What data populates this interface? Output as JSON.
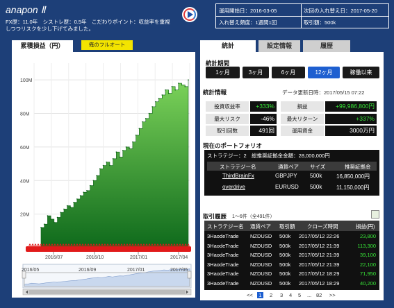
{
  "header": {
    "title": "anapon Ⅱ",
    "desc_line1": "FX歴：11.0年　シストレ歴：0.5年　こだわりポイント：収益率を重視",
    "desc_line2": "しつつリスクを少し下げてみました。",
    "info": {
      "start_label": "運用開始日：2016-03-05",
      "next_label": "次回の入れ替え日：2017-05-20",
      "freq_label": "入れ替え頻度：1週間1回",
      "lot_label": "取引額：500k"
    }
  },
  "left": {
    "tab": "累積損益（円）",
    "auto_button": "俺のフルオート"
  },
  "right": {
    "tabs": [
      "統計",
      "設定情報",
      "履歴"
    ],
    "period_title": "統計期間",
    "periods": [
      "1ヶ月",
      "3ヶ月",
      "6ヶ月",
      "12ヶ月",
      "稼働以来"
    ],
    "active_period": "12ヶ月",
    "stats_title": "統計情報",
    "updated": "データ更新日時：2017/05/15 07:22",
    "stats": [
      {
        "label": "投資収益率",
        "value": "+333%",
        "green": true
      },
      {
        "label": "損益",
        "value": "+99,986,800円",
        "green": true
      },
      {
        "label": "最大リスク",
        "value": "-46%",
        "green": false
      },
      {
        "label": "最大リターン",
        "value": "+337%",
        "green": true
      },
      {
        "label": "取引回数",
        "value": "491回",
        "green": false
      },
      {
        "label": "運用資金",
        "value": "3000万円",
        "green": false
      }
    ],
    "portfolio_title": "現在のポートフォリオ",
    "portfolio_summary": "ストラテジー：2　総推奨証拠金金額：28,000,000円",
    "portfolio_headers": [
      "ストラテジー名",
      "通貨ペア",
      "サイズ",
      "推奨証拠金"
    ],
    "portfolio_rows": [
      {
        "name": "ThirdBrainFx",
        "pair": "GBPJPY",
        "size": "500k",
        "margin": "16,850,000円"
      },
      {
        "name": "overdrive",
        "pair": "EURUSD",
        "size": "500k",
        "margin": "11,150,000円"
      }
    ],
    "history_title": "取引履歴",
    "history_count": "1〜6件（全491件）",
    "history_headers": [
      "ストラテジー名",
      "通貨ペア",
      "取引額",
      "クローズ時間",
      "損益(円)"
    ],
    "history_rows": [
      {
        "name": "3HaodeTrade",
        "pair": "NZDUSD",
        "amount": "500k",
        "time": "2017/05/12 22:26",
        "pl": "23,800"
      },
      {
        "name": "3HaodeTrade",
        "pair": "NZDUSD",
        "amount": "500k",
        "time": "2017/05/12 21:39",
        "pl": "113,300"
      },
      {
        "name": "3HaodeTrade",
        "pair": "NZDUSD",
        "amount": "500k",
        "time": "2017/05/12 21:39",
        "pl": "39,100"
      },
      {
        "name": "3HaodeTrade",
        "pair": "NZDUSD",
        "amount": "500k",
        "time": "2017/05/12 21:39",
        "pl": "22,100"
      },
      {
        "name": "3HaodeTrade",
        "pair": "NZDUSD",
        "amount": "500k",
        "time": "2017/05/12 18:29",
        "pl": "71,950"
      },
      {
        "name": "3HaodeTrade",
        "pair": "NZDUSD",
        "amount": "500k",
        "time": "2017/05/12 18:29",
        "pl": "40,200"
      }
    ],
    "pager": {
      "prev": "<<",
      "pages": [
        "1",
        "2",
        "3",
        "4",
        "5",
        "...",
        "82"
      ],
      "next": ">>",
      "current": "1"
    }
  },
  "chart_data": {
    "type": "area",
    "title": "",
    "ylabel": "",
    "ylim": [
      0,
      110000000
    ],
    "yticks": [
      "20M",
      "40M",
      "60M",
      "80M",
      "100M"
    ],
    "ytick_values": [
      20000000,
      40000000,
      60000000,
      80000000,
      100000000
    ],
    "xticks": [
      "2016/07",
      "2016/10",
      "2017/01",
      "2017/04"
    ],
    "navigator_xticks": [
      "2016/05",
      "2016/09",
      "2017/01",
      "2017/05"
    ],
    "series": [
      {
        "values": [
          12000000,
          14000000,
          19000000,
          17000000,
          15000000,
          18000000,
          21000000,
          23000000,
          25000000,
          24000000,
          27000000,
          29000000,
          31000000,
          33000000,
          34000000,
          37000000,
          40000000,
          43000000,
          47000000,
          49000000,
          51000000,
          49000000,
          53000000,
          57000000,
          54000000,
          58000000,
          60000000,
          59000000,
          63000000,
          67000000,
          71000000,
          75000000,
          77000000,
          80000000,
          84000000,
          87000000,
          89000000,
          91000000,
          94000000,
          92000000,
          96000000,
          94000000,
          98000000,
          97000000,
          96000000,
          100000000
        ]
      }
    ],
    "colors": {
      "area_top": "#7cd35a",
      "area_bottom": "#0f6a1c",
      "marker": "#e11a1a"
    }
  }
}
